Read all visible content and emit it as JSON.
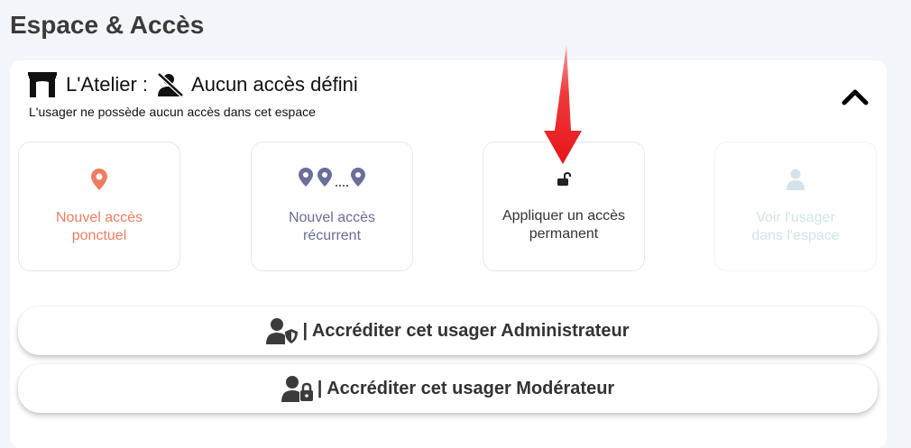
{
  "page": {
    "title": "Espace & Accès"
  },
  "space": {
    "icon": "gate-icon",
    "name": "L'Atelier :",
    "status_icon": "user-slash-icon",
    "status": "Aucun accès défini",
    "subtitle": "L'usager ne possède aucun accès dans cet espace",
    "collapse_icon": "chevron-up-icon"
  },
  "cards": [
    {
      "label": "Nouvel accès\nponctuel",
      "icon": "map-pin-icon",
      "color": "#ef7d62"
    },
    {
      "label": "Nouvel accès\nrécurrent",
      "icon": "multi-pin-icon",
      "color": "#6b6d9a"
    },
    {
      "label": "Appliquer un accès\npermanent",
      "icon": "unlock-icon",
      "color": "#333333"
    },
    {
      "label": "Voir l'usager\ndans l'espace",
      "icon": "user-icon",
      "color": "#d4e3ea",
      "disabled": true
    }
  ],
  "buttons": {
    "admin": {
      "label": "| Accréditer cet usager Administrateur",
      "icon": "user-shield-icon"
    },
    "moderator": {
      "label": "| Accréditer cet usager Modérateur",
      "icon": "user-lock-icon"
    }
  },
  "annotation": {
    "icon": "red-arrow-icon",
    "color": "#e8141a"
  }
}
